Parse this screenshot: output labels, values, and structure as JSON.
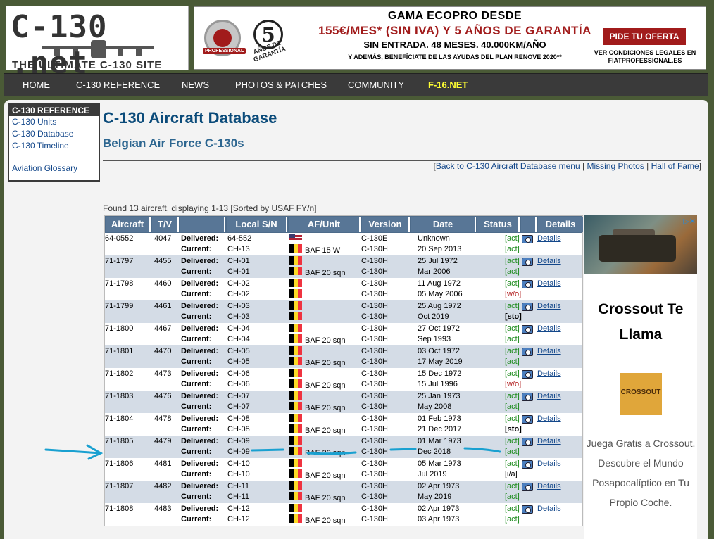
{
  "header": {
    "logo_main": "C-130 .net",
    "logo_tagline": "THE ULTIMATE C-130 SITE",
    "ad": {
      "brand_label": "PROFESSIONAL",
      "warranty_num": "5",
      "warranty_text": "AÑOS DE GARANTÍA",
      "line1": "GAMA ECOPRO DESDE",
      "line2": "155€/MES* (SIN IVA) Y 5 AÑOS DE GARANTÍA",
      "line3": "SIN ENTRADA. 48 MESES. 40.000KM/AÑO",
      "line4": "Y ADEMÁS, BENEFÍCIATE DE LAS AYUDAS DEL PLAN RENOVE 2020**",
      "cta": "PIDE TU OFERTA",
      "cta_sub": "VER CONDICIONES LEGALES EN FIATPROFESSIONAL.ES"
    }
  },
  "nav": {
    "items": [
      "HOME",
      "C-130 REFERENCE",
      "NEWS",
      "PHOTOS & PATCHES",
      "COMMUNITY",
      "F-16.NET"
    ]
  },
  "sidebar": {
    "heading": "C-130 REFERENCE",
    "links": [
      "C-130 Units",
      "C-130 Database",
      "C-130 Timeline",
      "Aviation Glossary"
    ]
  },
  "page": {
    "title": "C-130 Aircraft Database",
    "subtitle": "Belgian Air Force C-130s",
    "links": [
      "Back to C-130 Aircraft Database menu",
      "Missing Photos",
      "Hall of Fame"
    ],
    "found": "Found 13 aircraft, displaying 1-13 [Sorted by USAF FY/n]"
  },
  "table": {
    "headers": [
      "Aircraft",
      "T/V",
      "",
      "Local S/N",
      "AF/Unit",
      "Version",
      "Date",
      "Status",
      "",
      "Details"
    ],
    "delivered_label": "Delivered:",
    "current_label": "Current:",
    "details_label": "Details",
    "rows": [
      {
        "aircraft": "64-0552",
        "tv": "4047",
        "d_sn": "64-552",
        "c_sn": "CH-13",
        "d_flag": "us",
        "unit": "BAF 15 W",
        "d_ver": "C-130E",
        "c_ver": "C-130H",
        "d_date": "Unknown",
        "c_date": "20 Sep 2013",
        "d_status": "[act]",
        "c_status": "[act]",
        "d_cls": "st-act",
        "c_cls": "st-act"
      },
      {
        "aircraft": "71-1797",
        "tv": "4455",
        "d_sn": "CH-01",
        "c_sn": "CH-01",
        "d_flag": "be",
        "unit": "BAF 20 sqn",
        "d_ver": "C-130H",
        "c_ver": "C-130H",
        "d_date": "25 Jul 1972",
        "c_date": "Mar 2006",
        "d_status": "[act]",
        "c_status": "[act]",
        "d_cls": "st-act",
        "c_cls": "st-act"
      },
      {
        "aircraft": "71-1798",
        "tv": "4460",
        "d_sn": "CH-02",
        "c_sn": "CH-02",
        "d_flag": "be",
        "unit": "",
        "d_ver": "C-130H",
        "c_ver": "C-130H",
        "d_date": "11 Aug 1972",
        "c_date": "05 May 2006",
        "d_status": "[act]",
        "c_status": "[w/o]",
        "d_cls": "st-act",
        "c_cls": "st-wo"
      },
      {
        "aircraft": "71-1799",
        "tv": "4461",
        "d_sn": "CH-03",
        "c_sn": "CH-03",
        "d_flag": "be",
        "unit": "",
        "d_ver": "C-130H",
        "c_ver": "C-130H",
        "d_date": "25 Aug 1972",
        "c_date": "Oct 2019",
        "d_status": "[act]",
        "c_status": "[sto]",
        "d_cls": "st-act",
        "c_cls": "st-sto"
      },
      {
        "aircraft": "71-1800",
        "tv": "4467",
        "d_sn": "CH-04",
        "c_sn": "CH-04",
        "d_flag": "be",
        "unit": "BAF 20 sqn",
        "d_ver": "C-130H",
        "c_ver": "C-130H",
        "d_date": "27 Oct 1972",
        "c_date": "Sep 1993",
        "d_status": "[act]",
        "c_status": "[act]",
        "d_cls": "st-act",
        "c_cls": "st-act"
      },
      {
        "aircraft": "71-1801",
        "tv": "4470",
        "d_sn": "CH-05",
        "c_sn": "CH-05",
        "d_flag": "be",
        "unit": "BAF 20 sqn",
        "d_ver": "C-130H",
        "c_ver": "C-130H",
        "d_date": "03 Oct 1972",
        "c_date": "17 May 2019",
        "d_status": "[act]",
        "c_status": "[act]",
        "d_cls": "st-act",
        "c_cls": "st-act"
      },
      {
        "aircraft": "71-1802",
        "tv": "4473",
        "d_sn": "CH-06",
        "c_sn": "CH-06",
        "d_flag": "be",
        "unit": "BAF 20 sqn",
        "d_ver": "C-130H",
        "c_ver": "C-130H",
        "d_date": "15 Dec 1972",
        "c_date": "15 Jul 1996",
        "d_status": "[act]",
        "c_status": "[w/o]",
        "d_cls": "st-act",
        "c_cls": "st-wo"
      },
      {
        "aircraft": "71-1803",
        "tv": "4476",
        "d_sn": "CH-07",
        "c_sn": "CH-07",
        "d_flag": "be",
        "unit": "BAF 20 sqn",
        "d_ver": "C-130H",
        "c_ver": "C-130H",
        "d_date": "25 Jan 1973",
        "c_date": "May 2008",
        "d_status": "[act]",
        "c_status": "[act]",
        "d_cls": "st-act",
        "c_cls": "st-act"
      },
      {
        "aircraft": "71-1804",
        "tv": "4478",
        "d_sn": "CH-08",
        "c_sn": "CH-08",
        "d_flag": "be",
        "unit": "BAF 20 sqn",
        "d_ver": "C-130H",
        "c_ver": "C-130H",
        "d_date": "01 Feb 1973",
        "c_date": "21 Dec 2017",
        "d_status": "[act]",
        "c_status": "[sto]",
        "d_cls": "st-act",
        "c_cls": "st-sto"
      },
      {
        "aircraft": "71-1805",
        "tv": "4479",
        "d_sn": "CH-09",
        "c_sn": "CH-09",
        "d_flag": "be",
        "unit": "BAF 20 sqn",
        "d_ver": "C-130H",
        "c_ver": "C-130H",
        "d_date": "01 Mar 1973",
        "c_date": "Dec 2018",
        "d_status": "[act]",
        "c_status": "[act]",
        "d_cls": "st-act",
        "c_cls": "st-act"
      },
      {
        "aircraft": "71-1806",
        "tv": "4481",
        "d_sn": "CH-10",
        "c_sn": "CH-10",
        "d_flag": "be",
        "unit": "BAF 20 sqn",
        "d_ver": "C-130H",
        "c_ver": "C-130H",
        "d_date": "05 Mar 1973",
        "c_date": "Jul 2019",
        "d_status": "[act]",
        "c_status": "[i/a]",
        "d_cls": "st-act",
        "c_cls": "st-ia"
      },
      {
        "aircraft": "71-1807",
        "tv": "4482",
        "d_sn": "CH-11",
        "c_sn": "CH-11",
        "d_flag": "be",
        "unit": "BAF 20 sqn",
        "d_ver": "C-130H",
        "c_ver": "C-130H",
        "d_date": "02 Apr 1973",
        "c_date": "May 2019",
        "d_status": "[act]",
        "c_status": "[act]",
        "d_cls": "st-act",
        "c_cls": "st-act"
      },
      {
        "aircraft": "71-1808",
        "tv": "4483",
        "d_sn": "CH-12",
        "c_sn": "CH-12",
        "d_flag": "be",
        "unit": "BAF 20 sqn",
        "d_ver": "C-130H",
        "c_ver": "C-130H",
        "d_date": "02 Apr 1973",
        "c_date": "03 Apr 1973",
        "d_status": "[act]",
        "c_status": "[act]",
        "d_cls": "st-act",
        "c_cls": "st-act"
      }
    ]
  },
  "side_ad": {
    "title": "Crossout Te Llama",
    "logo": "CROSSOUT",
    "body": "Juega Gratis a Crossout. Descubre el Mundo Posapocalíptico en Tu Propio Coche."
  },
  "annotation": {
    "color": "#19a0d0",
    "highlighted_aircraft": "71-1805"
  }
}
